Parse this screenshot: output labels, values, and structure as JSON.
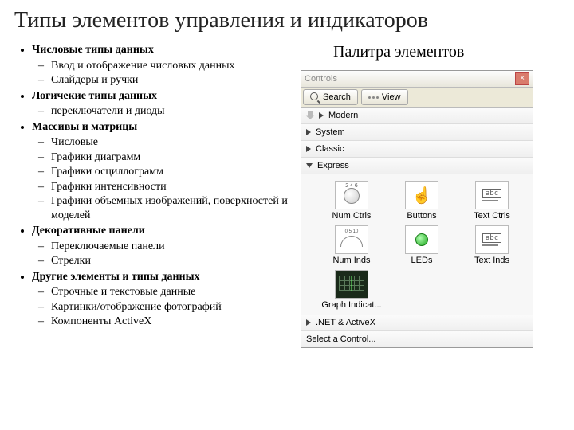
{
  "title": "Типы элементов управления и индикаторов",
  "bullets": [
    {
      "cat": "Числовые типы  данных",
      "subs": [
        "Ввод и отображение числовых данных",
        "Слайдеры  и  ручки"
      ]
    },
    {
      "cat": "Логичекие типы данных",
      "subs": [
        "переключатели и диоды"
      ]
    },
    {
      "cat": "Массивы и матрицы",
      "subs": [
        "Числовые",
        "Графики диаграмм",
        "Графики осциллограмм",
        "Графики интенсивности",
        "Графики объемных изображений, поверхностей и моделей"
      ]
    },
    {
      "cat": "Декоративные панели",
      "subs": [
        "Переключаемые панели",
        "Стрелки"
      ]
    },
    {
      "cat": "Другие элементы и типы данных",
      "subs": [
        "Строчные и текстовые  данные",
        "Картинки/отображение фотографий",
        "Компоненты ActiveX"
      ]
    }
  ],
  "right_title": "Палитра  элементов",
  "palette": {
    "window_title": "Controls",
    "search_label": "Search",
    "view_label": "View",
    "categories": {
      "modern": "Modern",
      "system": "System",
      "classic": "Classic",
      "express": "Express",
      "dotnet": ".NET & ActiveX",
      "select": "Select a Control..."
    },
    "express_items": {
      "num_ctrls": "Num Ctrls",
      "buttons": "Buttons",
      "text_ctrls": "Text Ctrls",
      "num_inds": "Num Inds",
      "leds": "LEDs",
      "text_inds": "Text Inds",
      "graph": "Graph Indicat..."
    },
    "abc": "abc"
  }
}
